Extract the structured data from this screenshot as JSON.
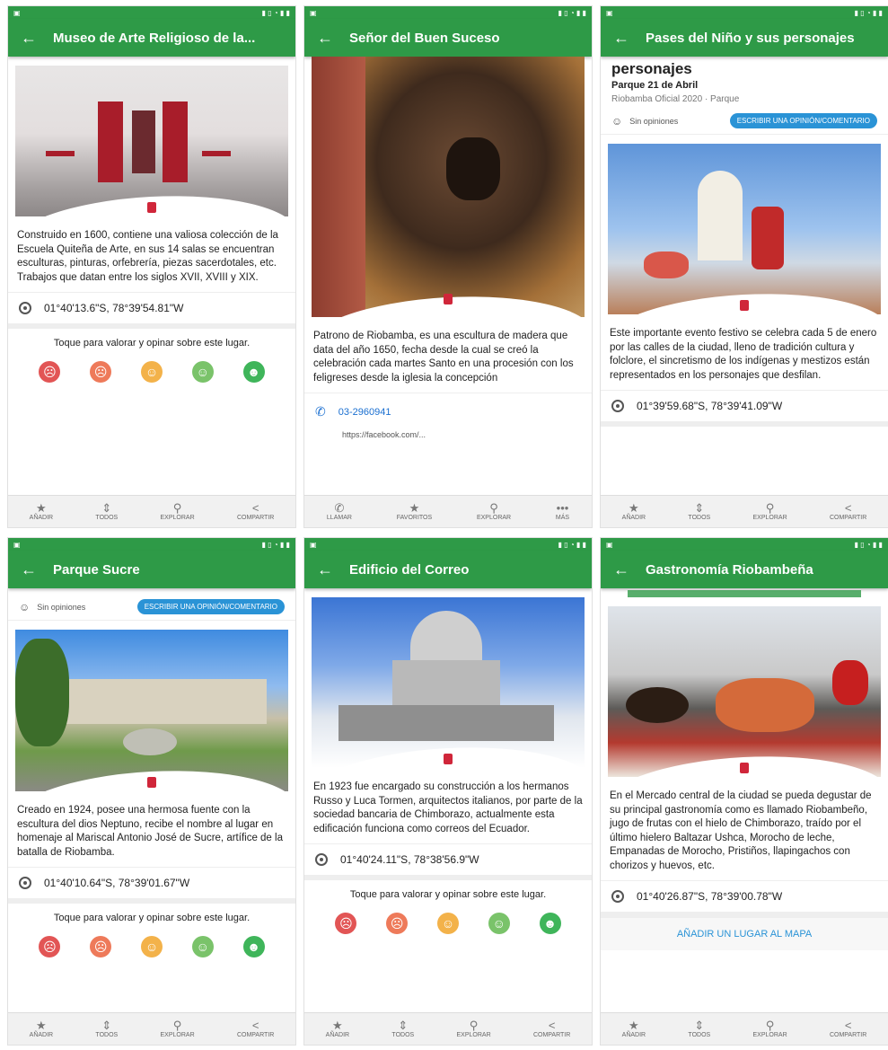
{
  "panels": [
    {
      "title": "Museo de Arte Religioso de la...",
      "description": "Construido en 1600, contiene una valiosa colección de la Escuela Quiteña de Arte, en sus 14 salas se encuentran esculturas, pinturas, orfebrería, piezas sacerdotales, etc. Trabajos que datan entre los siglos XVII, XVIII y XIX.",
      "coords": "01°40'13.6\"S, 78°39'54.81\"W",
      "rating_prompt": "Toque para valorar y opinar sobre este lugar.",
      "nav": [
        "AÑADIR",
        "TODOS",
        "EXPLORAR",
        "COMPARTIR"
      ]
    },
    {
      "title": "Señor del Buen Suceso",
      "description": "Patrono de Riobamba, es una escultura de madera que data del año 1650, fecha desde la cual se creó la celebración cada martes Santo en una procesión con los feligreses desde la iglesia la concepción",
      "phone": "03-2960941",
      "link": "https://facebook.com/...",
      "nav": [
        "LLAMAR",
        "FAVORITOS",
        "EXPLORAR",
        "MÁS"
      ]
    },
    {
      "title": "Pases del Niño y sus personajes",
      "heading": "personajes",
      "subheading": "Parque 21 de Abril",
      "source": "Riobamba Oficial 2020 · Parque",
      "opinion_btn": "ESCRIBIR UNA OPINIÓN/COMENTARIO",
      "no_opinions": "Sin opiniones",
      "description": "Este importante evento festivo se celebra cada 5 de enero por las calles de la ciudad, lleno de tradición cultura y folclore, el sincretismo de los indígenas y mestizos están representados en los personajes que desfilan.",
      "coords": "01°39'59.68\"S, 78°39'41.09\"W",
      "nav": [
        "AÑADIR",
        "TODOS",
        "EXPLORAR",
        "COMPARTIR"
      ]
    },
    {
      "title": "Parque Sucre",
      "no_opinions": "Sin opiniones",
      "opinion_btn": "ESCRIBIR UNA OPINIÓN/COMENTARIO",
      "description": "Creado en 1924, posee una hermosa fuente con la escultura del dios Neptuno, recibe el nombre al lugar en homenaje al Mariscal Antonio José de Sucre, artífice de la batalla de Riobamba.",
      "coords": "01°40'10.64\"S, 78°39'01.67\"W",
      "rating_prompt": "Toque para valorar y opinar sobre este lugar.",
      "nav": [
        "AÑADIR",
        "TODOS",
        "EXPLORAR",
        "COMPARTIR"
      ]
    },
    {
      "title": "Edificio del Correo",
      "description": "En 1923 fue encargado su construcción a los hermanos Russo y Luca Tormen, arquitectos italianos, por parte de la sociedad bancaria de Chimborazo, actualmente esta edificación funciona como correos del Ecuador.",
      "coords": "01°40'24.11\"S, 78°38'56.9\"W",
      "rating_prompt": "Toque para valorar y opinar sobre este lugar.",
      "nav": [
        "AÑADIR",
        "TODOS",
        "EXPLORAR",
        "COMPARTIR"
      ]
    },
    {
      "title": "Gastronomía Riobambeña",
      "description": "En el Mercado central de la ciudad se pueda degustar de su principal gastronomía como es llamado Riobambeño, jugo de frutas con el hielo de Chimborazo, traído por el último hielero Baltazar Ushca, Morocho de leche, Empanadas de Morocho, Pristiños, llapingachos con chorizos y huevos, etc.",
      "coords": "01°40'26.87\"S, 78°39'00.78\"W",
      "add_map": "AÑADIR UN LUGAR AL MAPA",
      "nav": [
        "AÑADIR",
        "TODOS",
        "EXPLORAR",
        "COMPARTIR"
      ]
    }
  ],
  "colors": {
    "green": "#2e9a47",
    "blue": "#2a93d6",
    "faces": [
      "#e25555",
      "#ee7a5a",
      "#f3b24a",
      "#7ac36a",
      "#3fb55a"
    ]
  },
  "icons": {
    "back": "arrow-left-icon",
    "location": "location-icon",
    "star": "star-icon",
    "share": "share-icon",
    "phone": "phone-icon"
  }
}
